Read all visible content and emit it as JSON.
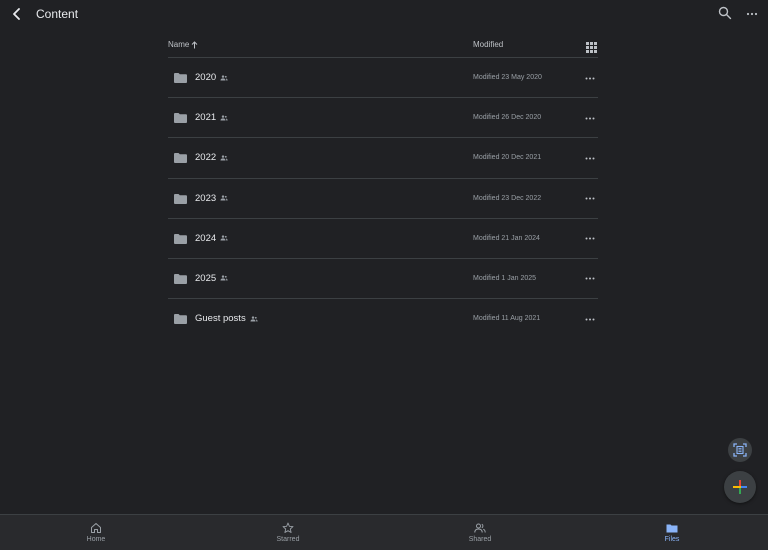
{
  "header": {
    "title": "Content"
  },
  "list": {
    "name_header": "Name",
    "modified_header": "Modified",
    "items": [
      {
        "name": "2020",
        "modified": "Modified 23 May 2020"
      },
      {
        "name": "2021",
        "modified": "Modified 26 Dec 2020"
      },
      {
        "name": "2022",
        "modified": "Modified 20 Dec 2021"
      },
      {
        "name": "2023",
        "modified": "Modified 23 Dec 2022"
      },
      {
        "name": "2024",
        "modified": "Modified 21 Jan 2024"
      },
      {
        "name": "2025",
        "modified": "Modified 1 Jan 2025"
      },
      {
        "name": "Guest posts",
        "modified": "Modified 11 Aug 2021"
      }
    ]
  },
  "bottom_nav": {
    "home": "Home",
    "starred": "Starred",
    "shared": "Shared",
    "files": "Files"
  },
  "colors": {
    "background": "#202124",
    "accent": "#8ab4f8",
    "folder": "#9aa0a6"
  }
}
